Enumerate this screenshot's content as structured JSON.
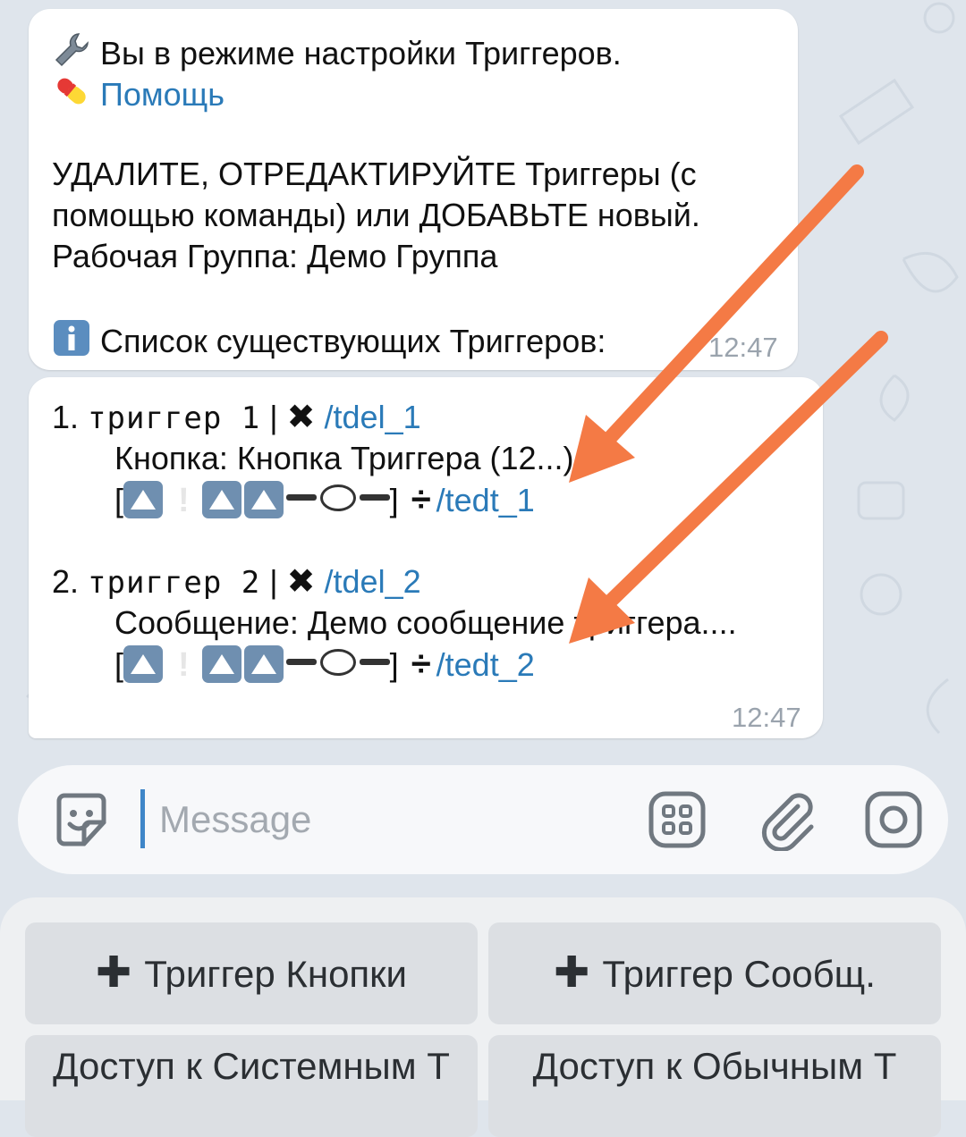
{
  "message1": {
    "line1": "Вы в режиме настройки Триггеров.",
    "help_link": "Помощь",
    "line3": "УДАЛИТЕ, ОТРЕДАКТИРУЙТЕ Триггеры (с",
    "line4": "помощью команды) или ДОБАВЬТЕ новый.",
    "line5": "Рабочая Группа: Демо Группа",
    "line6": "Список существующих Триггеров:",
    "time": "12:47"
  },
  "message2": {
    "triggers": [
      {
        "number": "1.",
        "name": "триггер 1",
        "sep": "|",
        "delete_cmd": "/tdel_1",
        "detail": "Кнопка: Кнопка Триггера (12...)",
        "edit_cmd": "/tedt_1"
      },
      {
        "number": "2.",
        "name": "триггер 2",
        "sep": "|",
        "delete_cmd": "/tdel_2",
        "detail": "Сообщение: Демо сообщение триггера....",
        "edit_cmd": "/tedt_2"
      }
    ],
    "bracket_open": "[",
    "bracket_close": "]",
    "time": "12:47"
  },
  "input": {
    "placeholder": "Message"
  },
  "keyboard": {
    "buttons": [
      "Триггер Кнопки",
      "Триггер Сообщ.",
      "Доступ к Системным Т",
      "Доступ к Обычным Т"
    ]
  },
  "icons": [
    "wrench-icon",
    "pill-icon",
    "info-icon",
    "cross-icon",
    "divide-icon",
    "up-arrow-icon",
    "exclamation-icon",
    "speech-icon",
    "sticker-icon",
    "bot-commands-icon",
    "attach-icon",
    "camera-icon",
    "plus-icon"
  ],
  "colors": {
    "link": "#2a7ab8",
    "annotation_arrow": "#f47a45",
    "caret": "#3f86c8"
  }
}
